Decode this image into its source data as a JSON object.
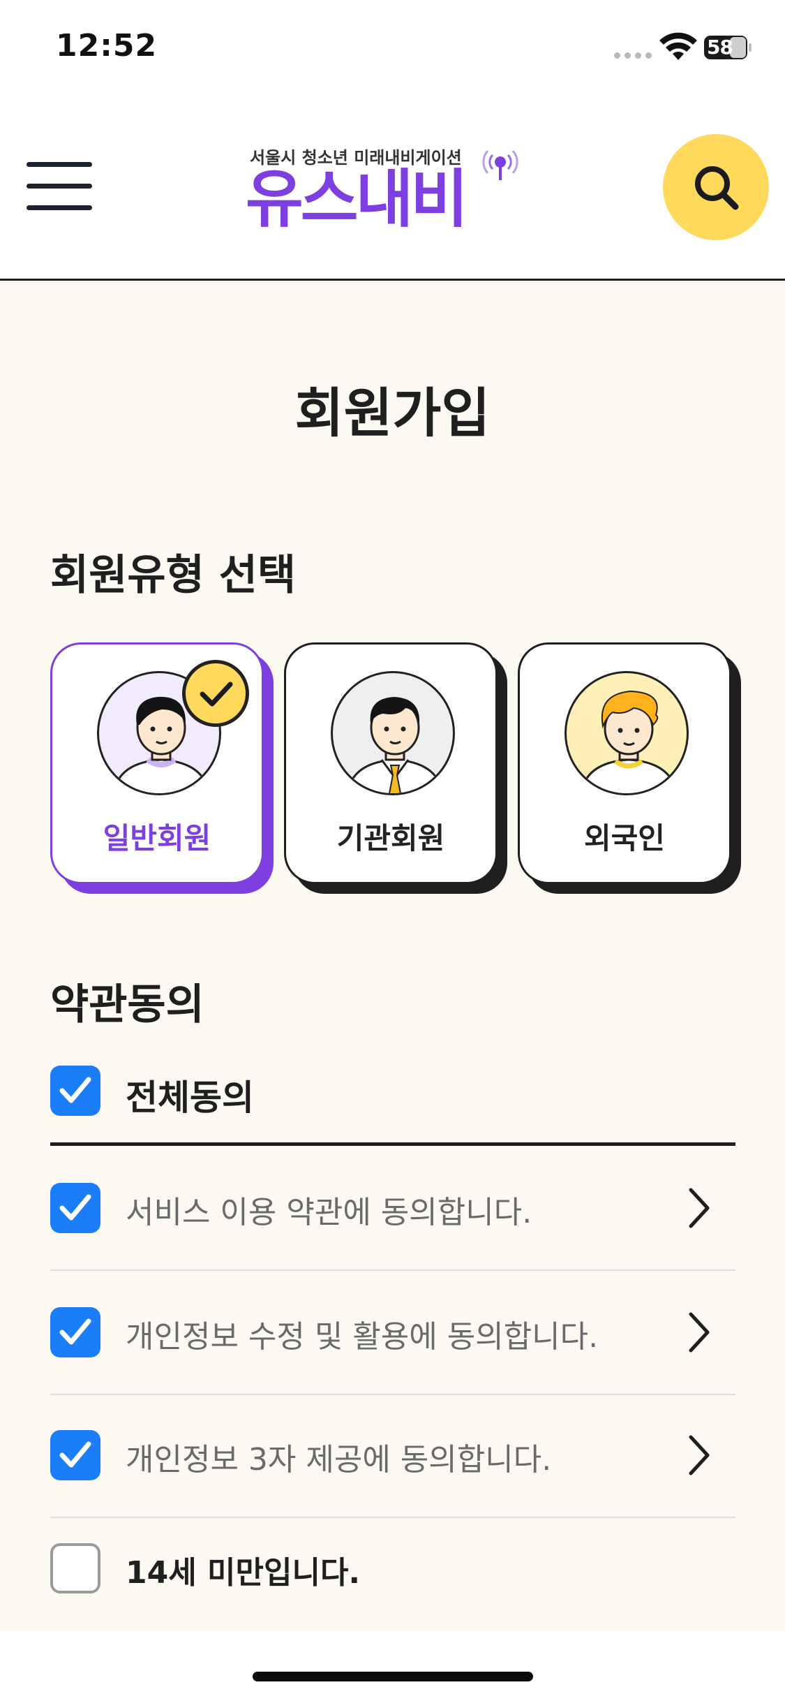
{
  "status_bar": {
    "time": "12:52",
    "battery": "58"
  },
  "header": {
    "logo_subtitle": "서울시 청소년 미래내비게이션",
    "logo_title": "유스내비",
    "menu_icon": "hamburger-menu-icon",
    "search_icon": "search-icon"
  },
  "page": {
    "title": "회원가입"
  },
  "member_type": {
    "title": "회원유형 선택",
    "options": [
      {
        "label": "일반회원",
        "selected": true
      },
      {
        "label": "기관회원",
        "selected": false
      },
      {
        "label": "외국인",
        "selected": false
      }
    ]
  },
  "terms": {
    "title": "약관동의",
    "agree_all": {
      "label": "전체동의",
      "checked": true
    },
    "items": [
      {
        "label": "서비스 이용 약관에 동의합니다.",
        "checked": true
      },
      {
        "label": "개인정보 수정 및 활용에 동의합니다.",
        "checked": true
      },
      {
        "label": "개인정보 3자 제공에 동의합니다.",
        "checked": true
      },
      {
        "label": "14세 미만입니다.",
        "checked": false
      }
    ]
  },
  "colors": {
    "brand_purple": "#7e3fe0",
    "accent_yellow": "#ffd95c",
    "checkbox_blue": "#1b7df7",
    "background": "#fbf9f2"
  }
}
